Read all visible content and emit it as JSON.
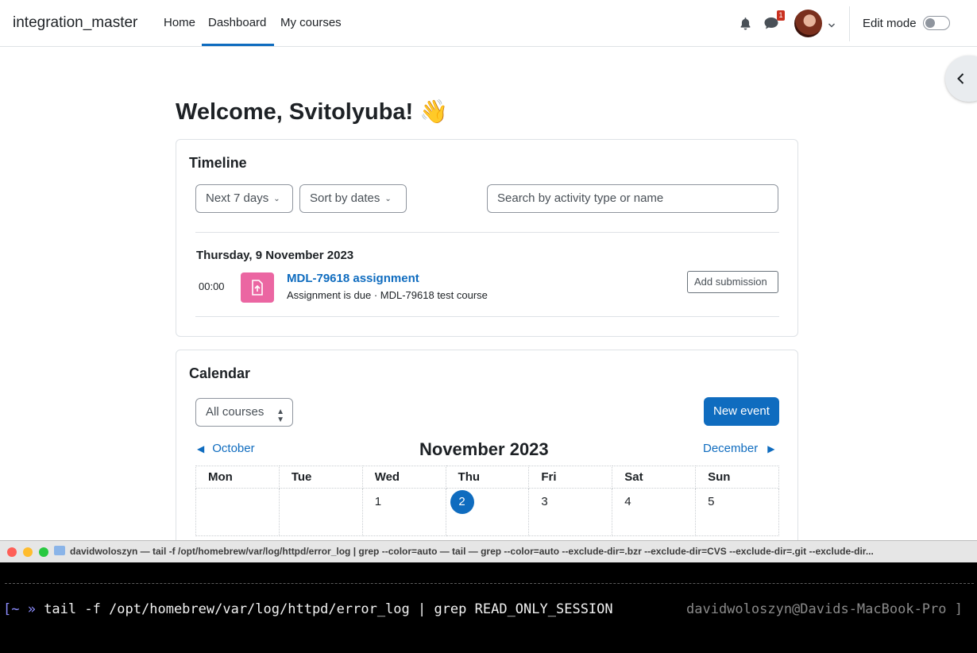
{
  "nav": {
    "brand": "integration_master",
    "links": [
      "Home",
      "Dashboard",
      "My courses"
    ],
    "message_badge": "1",
    "edit_mode_label": "Edit mode"
  },
  "page": {
    "welcome": "Welcome, Svitolyuba! 👋"
  },
  "timeline": {
    "title": "Timeline",
    "filter": "Next 7 days",
    "sort": "Sort by dates",
    "search_placeholder": "Search by activity type or name",
    "date_heading": "Thursday, 9 November 2023",
    "event": {
      "time": "00:00",
      "name": "MDL-79618 assignment",
      "subtitle": "Assignment is due · MDL-79618 test course",
      "action": "Add submission"
    }
  },
  "calendar": {
    "title": "Calendar",
    "course_filter": "All courses",
    "new_event": "New event",
    "prev_month": "October",
    "next_month": "December",
    "month_title": "November 2023",
    "weekdays": [
      "Mon",
      "Tue",
      "Wed",
      "Thu",
      "Fri",
      "Sat",
      "Sun"
    ],
    "first_week": [
      "",
      "",
      "1",
      "2",
      "3",
      "4",
      "5"
    ],
    "today_index": 3
  },
  "terminal": {
    "title": "davidwoloszyn — tail -f /opt/homebrew/var/log/httpd/error_log | grep --color=auto   — tail — grep --color=auto --exclude-dir=.bzr --exclude-dir=CVS --exclude-dir=.git --exclude-dir...",
    "prompt": "[~ »",
    "command": " tail -f /opt/homebrew/var/log/httpd/error_log | grep READ_ONLY_SESSION",
    "right_prompt": "davidwoloszyn@Davids-MacBook-Pro ]"
  }
}
